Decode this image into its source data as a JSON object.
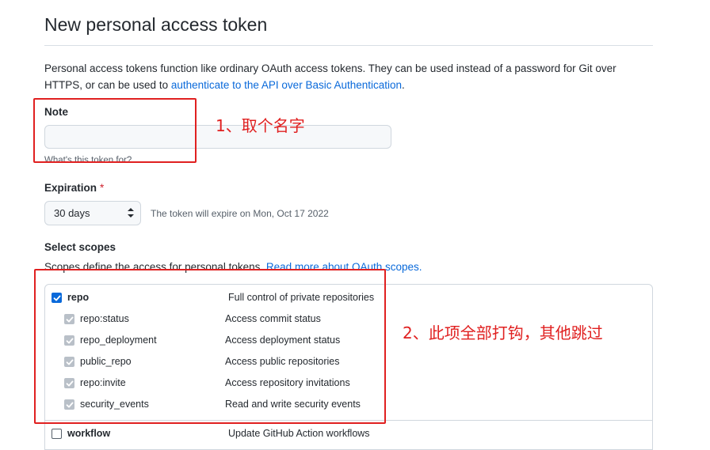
{
  "header": {
    "title": "New personal access token"
  },
  "description": {
    "text": "Personal access tokens function like ordinary OAuth access tokens. They can be used instead of a password for Git over HTTPS, or can be used to ",
    "link": "authenticate to the API over Basic Authentication",
    "suffix": "."
  },
  "note": {
    "label": "Note",
    "value": "",
    "placeholder": "",
    "hint": "What's this token for?"
  },
  "expiration": {
    "label": "Expiration",
    "required_mark": "*",
    "selected": "30 days",
    "hint": "The token will expire on Mon, Oct 17 2022"
  },
  "scopes": {
    "label": "Select scopes",
    "description": "Scopes define the access for personal tokens. ",
    "link": "Read more about OAuth scopes.",
    "items": [
      {
        "name": "repo",
        "description": "Full control of private repositories",
        "state": "checked"
      },
      {
        "name": "repo:status",
        "description": "Access commit status",
        "state": "checked-disabled"
      },
      {
        "name": "repo_deployment",
        "description": "Access deployment status",
        "state": "checked-disabled"
      },
      {
        "name": "public_repo",
        "description": "Access public repositories",
        "state": "checked-disabled"
      },
      {
        "name": "repo:invite",
        "description": "Access repository invitations",
        "state": "checked-disabled"
      },
      {
        "name": "security_events",
        "description": "Read and write security events",
        "state": "checked-disabled"
      },
      {
        "name": "workflow",
        "description": "Update GitHub Action workflows",
        "state": "unchecked"
      }
    ]
  },
  "annotations": {
    "note": "1、取个名字",
    "repo": "2、此项全部打钩，其他跳过",
    "color": "#e02020"
  },
  "colors": {
    "link": "#0969da",
    "checkbox": "#0969da",
    "required": "#cf222e"
  }
}
